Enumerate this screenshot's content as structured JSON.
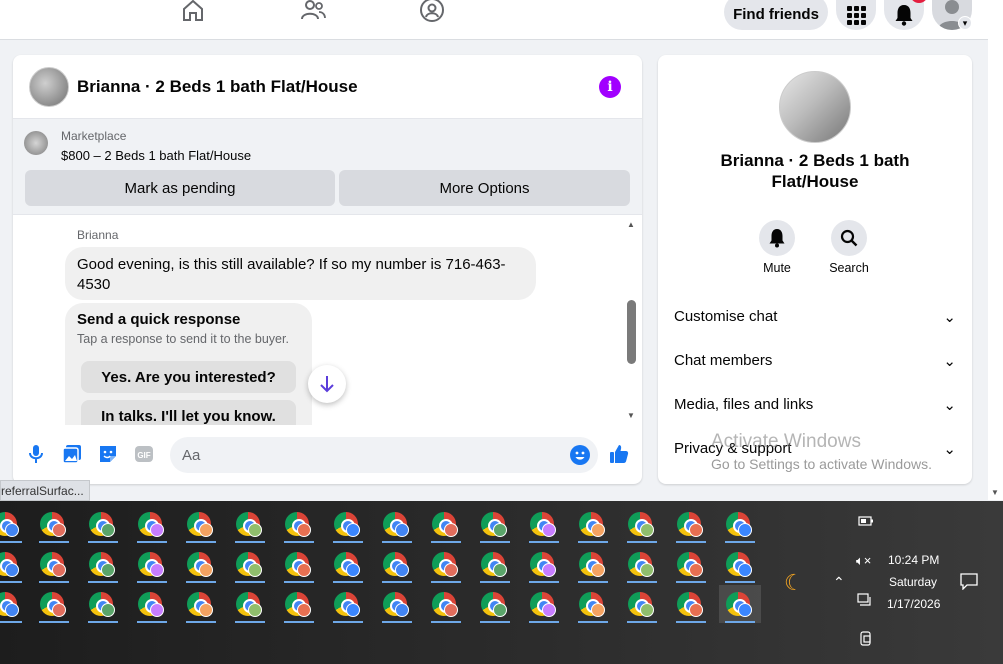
{
  "topbar": {
    "find_friends": "Find friends",
    "notification_badge": ""
  },
  "chat": {
    "title": "Brianna · 2 Beds 1 bath Flat/House",
    "marketplace_label": "Marketplace",
    "listing": "$800 – 2 Beds 1 bath Flat/House",
    "mark_pending": "Mark as pending",
    "more_options": "More Options",
    "sender": "Brianna",
    "message": "Good evening, is this still available? If so my number is 716-463-4530",
    "quick_title": "Send a quick response",
    "quick_sub": "Tap a response to send it to the buyer.",
    "quick_options": [
      "Yes. Are you interested?",
      "In talks. I'll let you know."
    ],
    "input_placeholder": "Aa"
  },
  "side": {
    "name": "Brianna · 2 Beds 1 bath Flat/House",
    "mute": "Mute",
    "search": "Search",
    "sections": [
      "Customise chat",
      "Chat members",
      "Media, files and links",
      "Privacy & support"
    ]
  },
  "watermark": {
    "line1": "Activate Windows",
    "line2": "Go to Settings to activate Windows."
  },
  "url_fragment": "referralSurfac...",
  "clock": {
    "time": "10:24 PM",
    "day": "Saturday",
    "date": "1/17/2026"
  },
  "colors": {
    "accent": "#1877f2",
    "info": "#a100ff",
    "badge": "#e41e3f"
  }
}
